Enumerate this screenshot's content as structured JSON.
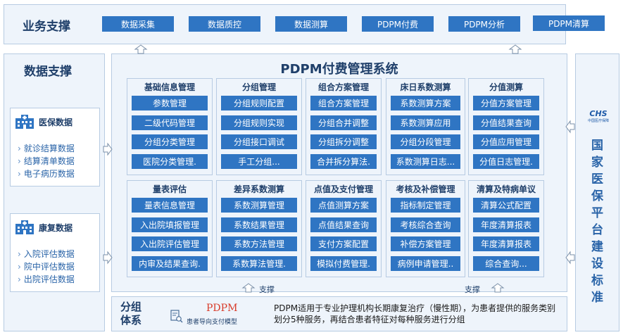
{
  "business_support": {
    "title": "业务支撑",
    "items": [
      "数据采集",
      "数据质控",
      "数据测算",
      "PDPM付费",
      "PDPM分析",
      "PDPM清算"
    ]
  },
  "data_support": {
    "title": "数据支撑",
    "medical_insurance": {
      "title": "医保数据",
      "items": [
        "就诊结算数据",
        "结算清单数据",
        "电子病历数据"
      ]
    },
    "rehab": {
      "title": "康复数据",
      "items": [
        "入院评估数据",
        "院中评估数据",
        "出院评估数据"
      ]
    }
  },
  "system": {
    "title": "PDPM付费管理系统",
    "groups": [
      {
        "title": "基础信息管理",
        "items": [
          "参数管理",
          "二级代码管理",
          "分组分类管理",
          "医院分类管理."
        ]
      },
      {
        "title": "分组管理",
        "items": [
          "分组规则配置",
          "分组规则实现",
          "分组接口调试",
          "手工分组..."
        ]
      },
      {
        "title": "组合方案管理",
        "items": [
          "组合方案管理",
          "分组合并调整",
          "分组拆分调整",
          "合并拆分算法."
        ]
      },
      {
        "title": "床日系数测算",
        "items": [
          "系数测算方案",
          "系数测算应用",
          "分组分段管理",
          "系数测算日志..."
        ]
      },
      {
        "title": "分值测算",
        "items": [
          "分值方案管理",
          "分值结果查询",
          "分值应用管理",
          "分值日志管理."
        ]
      },
      {
        "title": "量表评估",
        "items": [
          "量表信息管理",
          "入出院填报管理",
          "入出院评估管理",
          "内审及结果查询."
        ]
      },
      {
        "title": "差异系数测算",
        "items": [
          "系数测算管理",
          "系数结果管理",
          "系数方法管理",
          "系数算法管理."
        ]
      },
      {
        "title": "点值及支付管理",
        "items": [
          "点值测算方案",
          "点值结果查询",
          "支付方案配置",
          "模拟付费管理."
        ]
      },
      {
        "title": "考核及补偿管理",
        "items": [
          "指标制定管理",
          "考核综合查询",
          "补偿方案管理",
          "病例申请管理.."
        ]
      },
      {
        "title": "清算及特病单议",
        "items": [
          "清算公式配置",
          "年度清算报表",
          "年度清算报表",
          "综合查询..."
        ]
      }
    ]
  },
  "standard": {
    "logo_main": "CHS",
    "logo_sub": "中国医疗保障",
    "title_chars": [
      "国",
      "家",
      "医",
      "保",
      "平",
      "台",
      "建",
      "设",
      "标",
      "准"
    ]
  },
  "grouping": {
    "title_line1": "分组",
    "title_line2": "体系",
    "logo_word": "PDPM",
    "logo_caption": "患者导向支付模型",
    "description": "PDPM适用于专业护理机构长期康复治疗（慢性期），为患者提供的服务类别划分5种服务，再结合患者特征对每种服务进行分组"
  },
  "labels": {
    "support_left": "支撑",
    "support_right": "支撑"
  },
  "colors": {
    "accent_blue": "#2f75c3",
    "panel_bg": "#eef4fb",
    "border": "#b7cbe2",
    "title_text": "#1f3f6a",
    "logo_red": "#d83b2a"
  }
}
